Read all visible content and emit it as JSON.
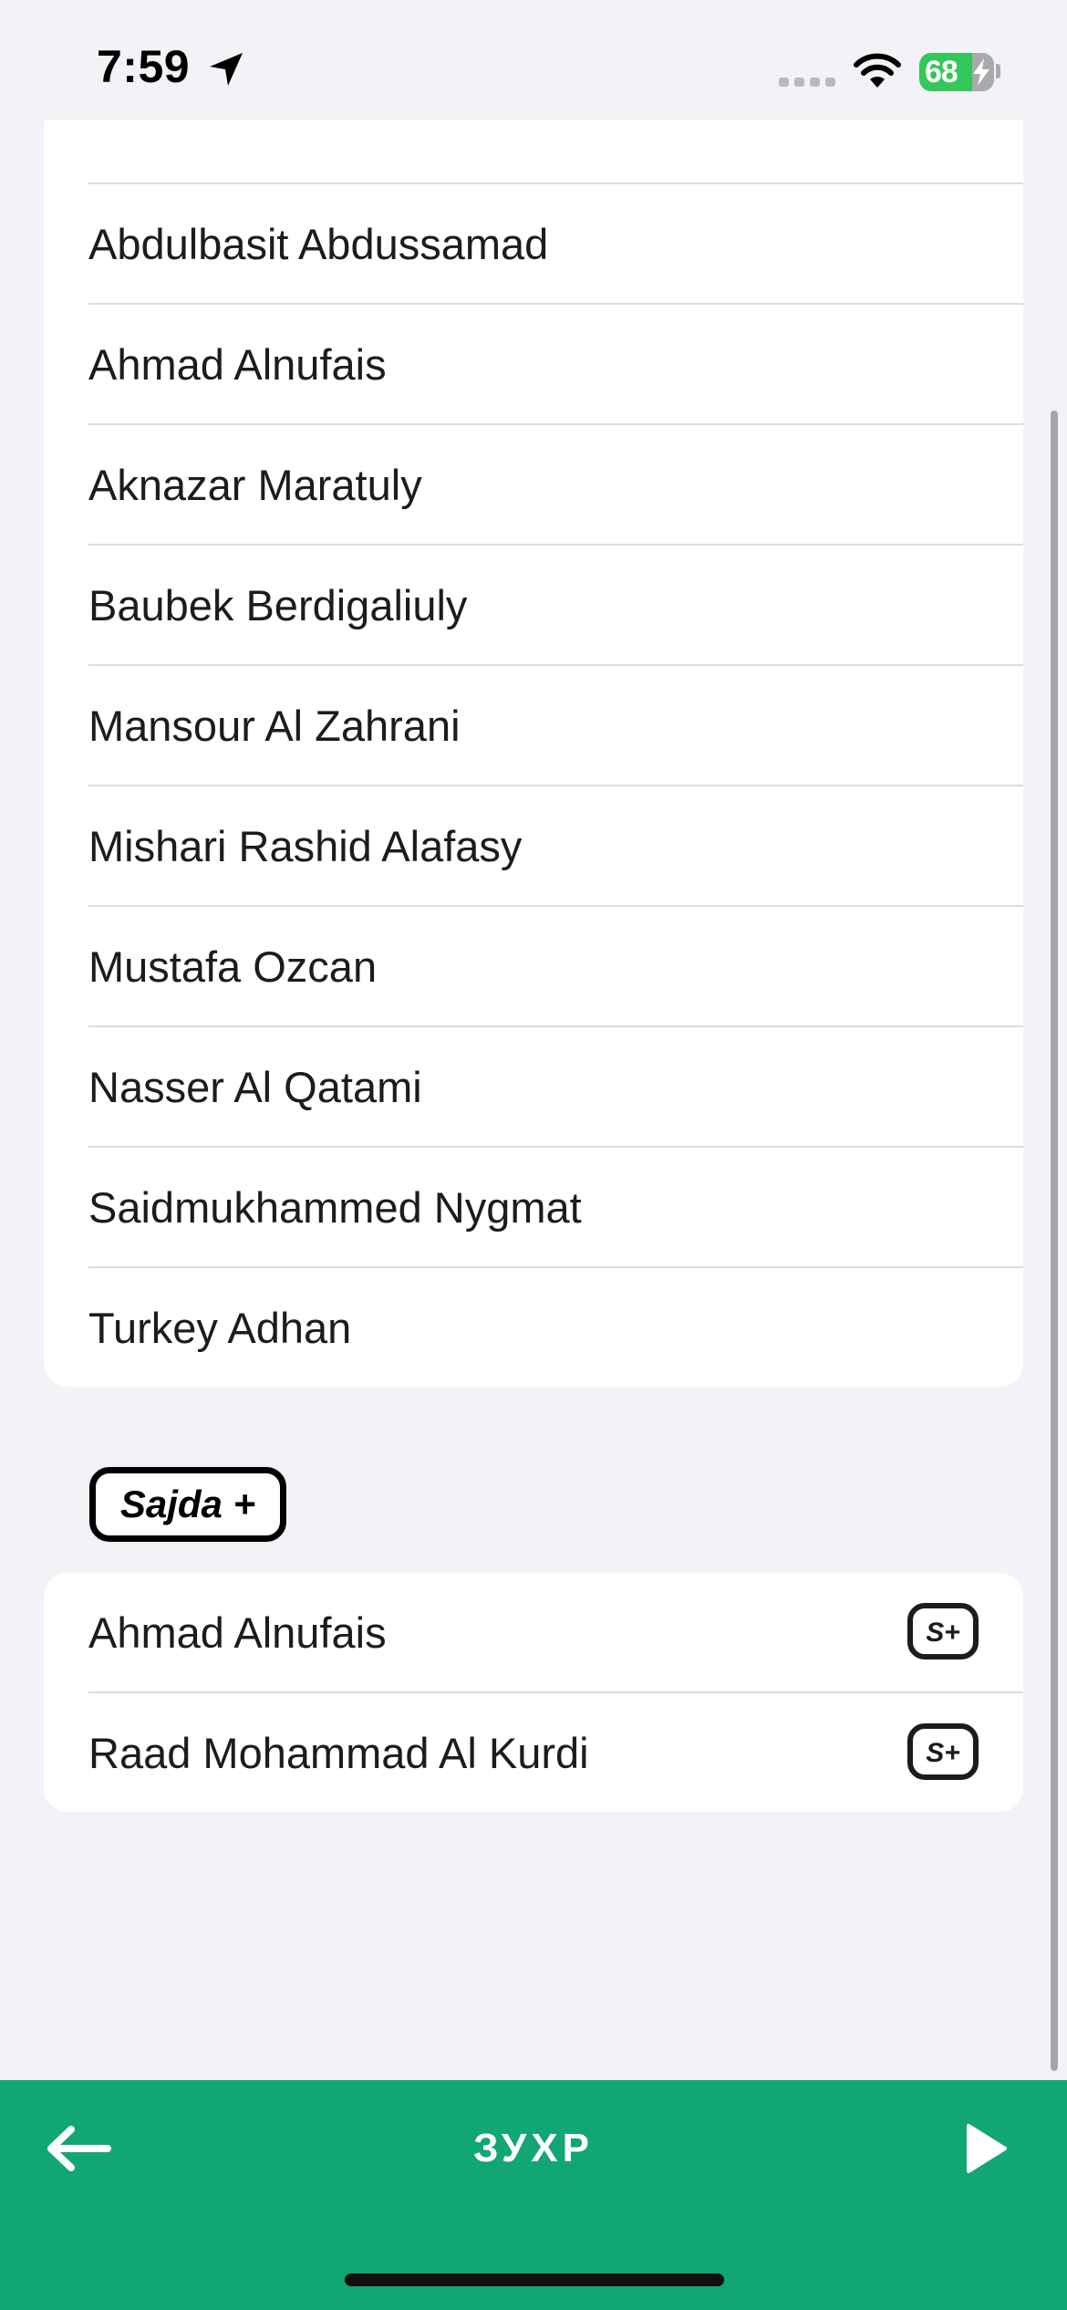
{
  "status_bar": {
    "time": "7:59",
    "battery_level": "68",
    "battery_color": "#34c759"
  },
  "reciters": {
    "top_item_icon": "cat-face-emoji",
    "items": [
      {
        "label": "Abdulbasit Abdussamad"
      },
      {
        "label": "Ahmad Alnufais"
      },
      {
        "label": "Aknazar Maratuly"
      },
      {
        "label": "Baubek Berdigaliuly"
      },
      {
        "label": "Mansour Al Zahrani"
      },
      {
        "label": "Mishari Rashid Alafasy"
      },
      {
        "label": "Mustafa Ozcan"
      },
      {
        "label": "Nasser Al Qatami"
      },
      {
        "label": "Saidmukhammed Nygmat"
      },
      {
        "label": "Turkey Adhan"
      }
    ]
  },
  "premium_section": {
    "badge_label": "Sajda +",
    "item_badge_icon": "s-plus-badge-icon",
    "items": [
      {
        "label": "Ahmad Alnufais"
      },
      {
        "label": "Raad Mohammad Al Kurdi"
      }
    ]
  },
  "bottom_bar": {
    "title": "ЗУХР",
    "back_icon": "arrow-left-icon",
    "play_icon": "play-icon",
    "background_color": "#12a673"
  },
  "colors": {
    "page_background": "#f2f2f7",
    "card_background": "#ffffff",
    "divider": "#dcdce0",
    "accent_green": "#12a673"
  }
}
